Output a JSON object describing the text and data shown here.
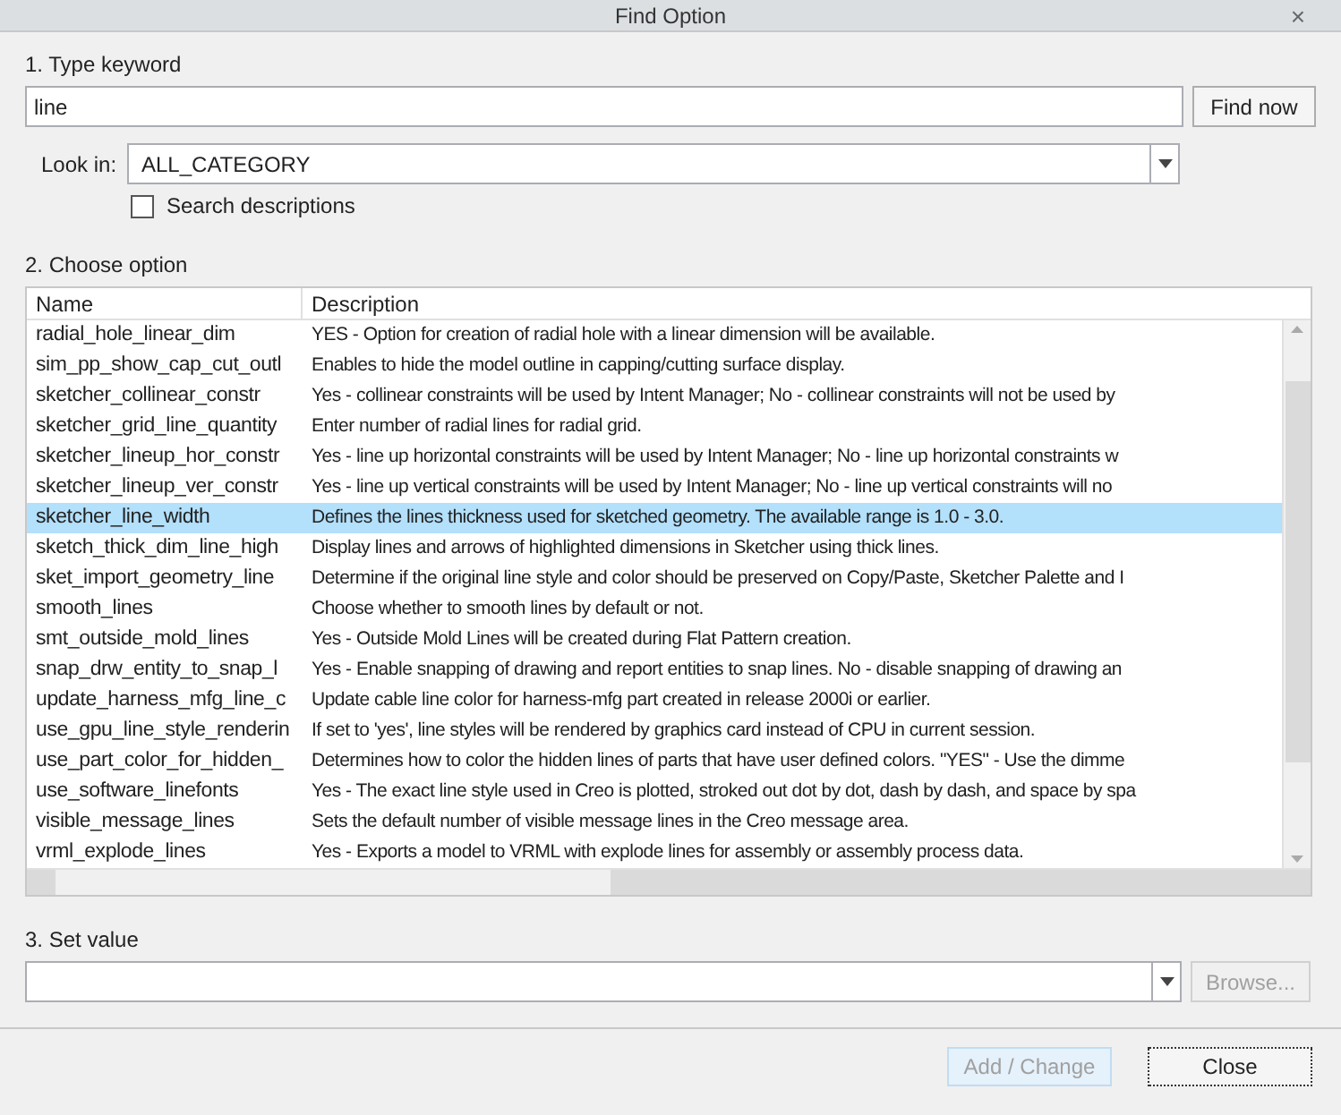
{
  "window": {
    "title": "Find Option",
    "close": "×"
  },
  "keyword": {
    "label": "1.  Type keyword",
    "value": "line",
    "button": "Find now"
  },
  "look_in": {
    "label": "Look in:",
    "value": "ALL_CATEGORY"
  },
  "search_descriptions": {
    "label": "Search descriptions",
    "checked": false
  },
  "options": {
    "label": "2.  Choose option",
    "columns": [
      "Name",
      "Description"
    ],
    "rows": [
      {
        "name": "radial_hole_linear_dim",
        "description": "YES - Option for creation of radial hole with a linear dimension will be available.",
        "selected": false
      },
      {
        "name": "sim_pp_show_cap_cut_outl",
        "description": "Enables to hide the model outline in capping/cutting surface display.",
        "selected": false
      },
      {
        "name": "sketcher_collinear_constr",
        "description": "Yes - collinear constraints will be used by Intent Manager; No - collinear constraints will not be used by",
        "selected": false
      },
      {
        "name": "sketcher_grid_line_quantity",
        "description": "Enter number of radial lines for radial grid.",
        "selected": false
      },
      {
        "name": "sketcher_lineup_hor_constr",
        "description": "Yes - line up horizontal constraints will be used by Intent Manager; No - line up horizontal constraints w",
        "selected": false
      },
      {
        "name": "sketcher_lineup_ver_constr",
        "description": "Yes - line up vertical constraints will be used by Intent Manager; No - line up vertical constraints will no",
        "selected": false
      },
      {
        "name": "sketcher_line_width",
        "description": "Defines the lines thickness used for sketched geometry. The available range is 1.0 - 3.0.",
        "selected": true
      },
      {
        "name": "sketch_thick_dim_line_high",
        "description": "Display lines and arrows of highlighted dimensions in Sketcher using thick lines.",
        "selected": false
      },
      {
        "name": "sket_import_geometry_line",
        "description": "Determine if the original line style and color should be preserved on Copy/Paste, Sketcher Palette and I",
        "selected": false
      },
      {
        "name": "smooth_lines",
        "description": "Choose whether to smooth lines by default or not.",
        "selected": false
      },
      {
        "name": "smt_outside_mold_lines",
        "description": "Yes - Outside Mold Lines will be created during Flat Pattern creation.",
        "selected": false
      },
      {
        "name": "snap_drw_entity_to_snap_l",
        "description": "Yes - Enable snapping of drawing and report entities to snap lines. No - disable snapping of drawing an",
        "selected": false
      },
      {
        "name": "update_harness_mfg_line_c",
        "description": "Update cable line color for harness-mfg part created in release 2000i or earlier.",
        "selected": false
      },
      {
        "name": "use_gpu_line_style_renderin",
        "description": "If set to 'yes', line styles will be rendered by graphics card instead of CPU in current session.",
        "selected": false
      },
      {
        "name": "use_part_color_for_hidden_",
        "description": "Determines how to color the hidden lines of parts that have user defined colors. \"YES\" - Use the dimme",
        "selected": false
      },
      {
        "name": "use_software_linefonts",
        "description": "Yes - The exact line style used in Creo is plotted, stroked out dot by dot, dash by dash, and space by spa",
        "selected": false
      },
      {
        "name": "visible_message_lines",
        "description": "Sets the default number of visible message lines in the Creo message area.",
        "selected": false
      },
      {
        "name": "vrml_explode_lines",
        "description": "Yes - Exports a model to VRML with explode lines for assembly or assembly process data.",
        "selected": false
      }
    ]
  },
  "set_value": {
    "label": "3.  Set value",
    "browse": {
      "label": "Browse...",
      "disabled": true
    }
  },
  "buttons": [
    {
      "label": "Add / Change",
      "disabled": true
    },
    {
      "label": "Close",
      "disabled": false
    }
  ]
}
